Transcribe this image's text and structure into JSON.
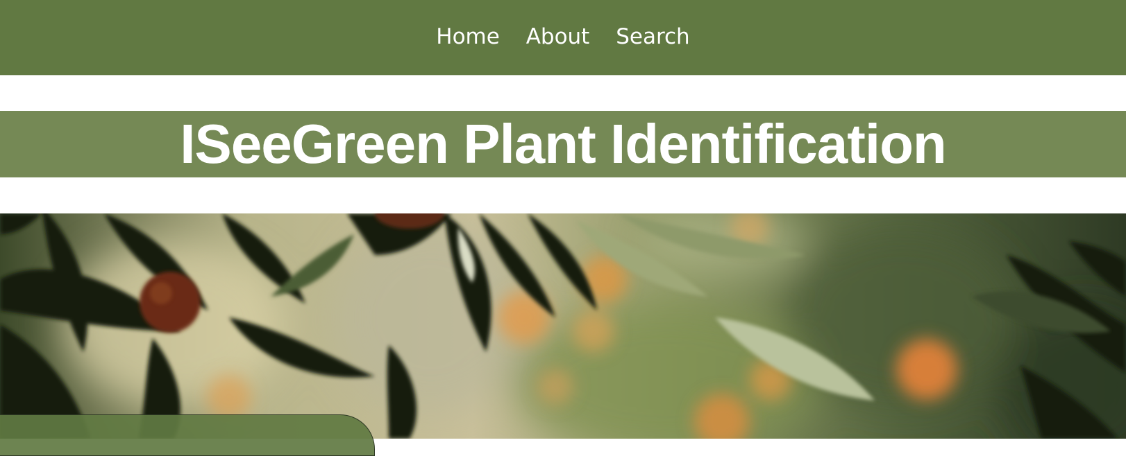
{
  "nav": {
    "items": [
      {
        "label": "Home"
      },
      {
        "label": "About"
      },
      {
        "label": "Search"
      }
    ]
  },
  "header": {
    "title": "ISeeGreen Plant Identification"
  },
  "colors": {
    "nav_background": "#617942",
    "title_band": "#758955",
    "text": "#ffffff"
  },
  "hero": {
    "image_subject": "leafy citrus tree branches with small orange fruits",
    "image_icon": "photo-icon"
  }
}
